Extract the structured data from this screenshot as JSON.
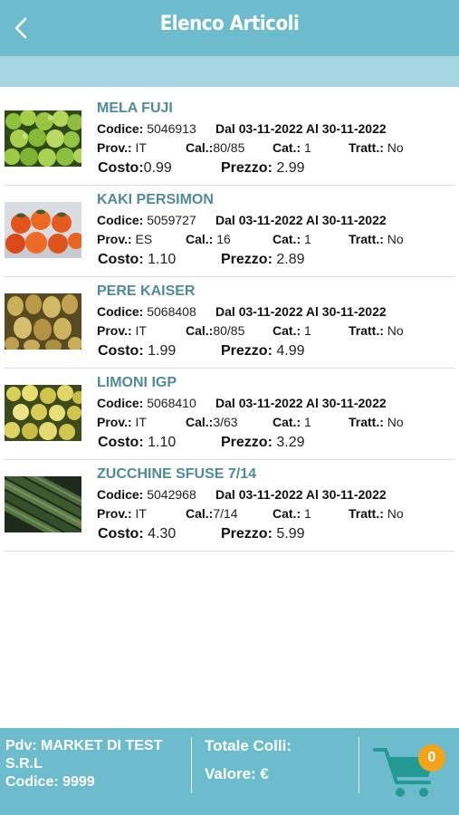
{
  "header": {
    "title": "Elenco Articoli",
    "back_icon": "chevron-left-icon"
  },
  "labels": {
    "codice": "Codice:",
    "dal": "Dal",
    "al": "Al",
    "prov": "Prov.:",
    "cal": "Cal.:",
    "cat": "Cat.:",
    "tratt": "Tratt.:",
    "costo": "Costo:",
    "prezzo": "Prezzo:"
  },
  "items": [
    {
      "name": "MELA FUJI",
      "codice": "5046913",
      "dal": "03-11-2022",
      "al": "30-11-2022",
      "prov": "IT",
      "cal": "80/85",
      "cat": "1",
      "tratt": "No",
      "costo": "0.99",
      "prezzo": "2.99",
      "image": "apples-photo"
    },
    {
      "name": "KAKI PERSIMON",
      "codice": "5059727",
      "dal": "03-11-2022",
      "al": "30-11-2022",
      "prov": "ES",
      "cal": "16",
      "cat": "1",
      "tratt": "No",
      "costo": "1.10",
      "prezzo": "2.89",
      "image": "persimmons-photo"
    },
    {
      "name": "PERE KAISER",
      "codice": "5068408",
      "dal": "03-11-2022",
      "al": "30-11-2022",
      "prov": "IT",
      "cal": "80/85",
      "cat": "1",
      "tratt": "No",
      "costo": "1.99",
      "prezzo": "4.99",
      "image": "pears-photo"
    },
    {
      "name": "LIMONI IGP",
      "codice": "5068410",
      "dal": "03-11-2022",
      "al": "30-11-2022",
      "prov": "IT",
      "cal": "3/63",
      "cat": "1",
      "tratt": "No",
      "costo": "1.10",
      "prezzo": "3.29",
      "image": "lemons-photo"
    },
    {
      "name": "ZUCCHINE SFUSE 7/14",
      "codice": "5042968",
      "dal": "03-11-2022",
      "al": "30-11-2022",
      "prov": "IT",
      "cal": "7/14",
      "cat": "1",
      "tratt": "No",
      "costo": "4.30",
      "prezzo": "5.99",
      "image": "zucchini-photo"
    }
  ],
  "footer": {
    "pdv_line1": "Pdv: MARKET DI TEST",
    "pdv_line2": "S.R.L",
    "codice_line": "Codice: 9999",
    "totale_colli": "Totale Colli:",
    "valore": "Valore: €",
    "cart_count": "0",
    "cart_icon": "shopping-cart-icon"
  },
  "colors": {
    "header": "#6dbccd",
    "subbar": "#a5d6e2",
    "product_name": "#4f8c98",
    "cart": "#239b94",
    "badge": "#f2a31a"
  }
}
